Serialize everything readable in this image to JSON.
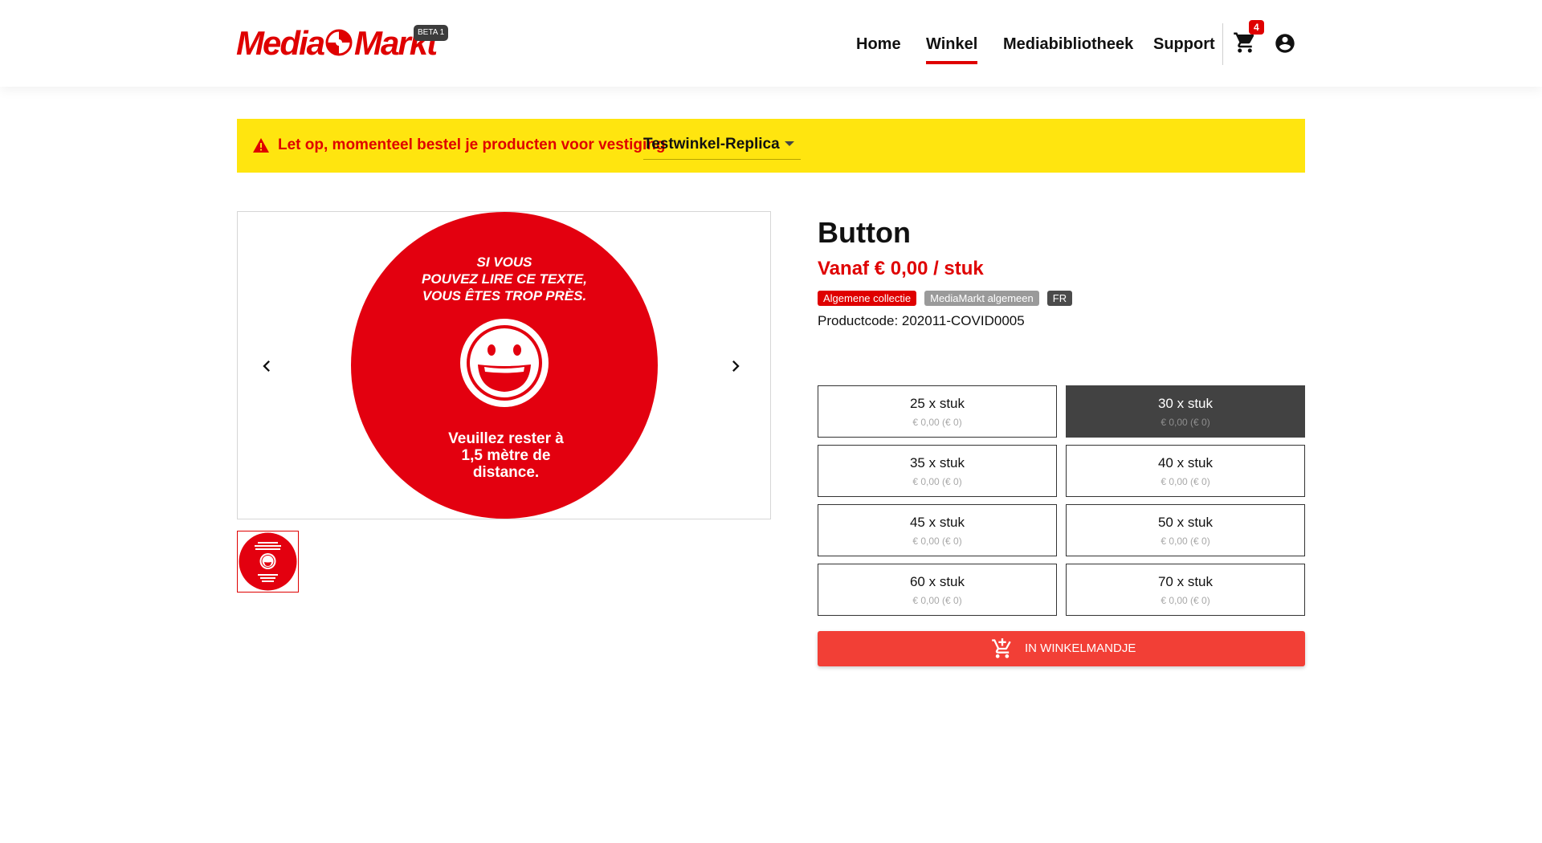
{
  "header": {
    "logo_text_left": "Media",
    "logo_text_right": "Markt",
    "beta_label": "BETA 1",
    "nav": [
      {
        "label": "Home",
        "active": false
      },
      {
        "label": "Winkel",
        "active": true
      },
      {
        "label": "Mediabibliotheek",
        "active": false
      },
      {
        "label": "Support",
        "active": false
      }
    ],
    "cart_count": "4",
    "icons": {
      "cart": "shopping-cart-icon",
      "account": "account-circle-icon"
    }
  },
  "banner": {
    "message": "Let op, momenteel bestel je producten voor vestiging",
    "store": "Testwinkel-Replica",
    "icon": "warning-icon"
  },
  "gallery": {
    "image_text_top": [
      "SI VOUS",
      "POUVEZ LIRE CE TEXTE,",
      "VOUS ÊTES TROP PRÈS."
    ],
    "image_text_bottom": [
      "Veuillez rester à",
      "1,5 mètre de",
      "distance."
    ],
    "icons": {
      "prev": "chevron-left-icon",
      "next": "chevron-right-icon"
    }
  },
  "product": {
    "title": "Button",
    "price": "Vanaf € 0,00 / stuk",
    "tags": [
      {
        "label": "Algemene collectie",
        "style": "red"
      },
      {
        "label": "MediaMarkt algemeen",
        "style": "grey"
      },
      {
        "label": "FR",
        "style": "dark"
      }
    ],
    "code": "Productcode: 202011-COVID0005"
  },
  "options": [
    {
      "qty": "25 x stuk",
      "price": "€ 0,00 (€ 0)",
      "selected": false
    },
    {
      "qty": "30 x stuk",
      "price": "€ 0,00 (€ 0)",
      "selected": true
    },
    {
      "qty": "35 x stuk",
      "price": "€ 0,00 (€ 0)",
      "selected": false
    },
    {
      "qty": "40 x stuk",
      "price": "€ 0,00 (€ 0)",
      "selected": false
    },
    {
      "qty": "45 x stuk",
      "price": "€ 0,00 (€ 0)",
      "selected": false
    },
    {
      "qty": "50 x stuk",
      "price": "€ 0,00 (€ 0)",
      "selected": false
    },
    {
      "qty": "60 x stuk",
      "price": "€ 0,00 (€ 0)",
      "selected": false
    },
    {
      "qty": "70 x stuk",
      "price": "€ 0,00 (€ 0)",
      "selected": false
    }
  ],
  "add_to_cart": {
    "label": "IN WINKELMANDJE",
    "icon": "add-shopping-cart-icon"
  },
  "colors": {
    "brand_red": "#df0000",
    "banner_yellow": "#ffe50f",
    "button_red": "#f23f36",
    "selected_option": "#424242"
  }
}
